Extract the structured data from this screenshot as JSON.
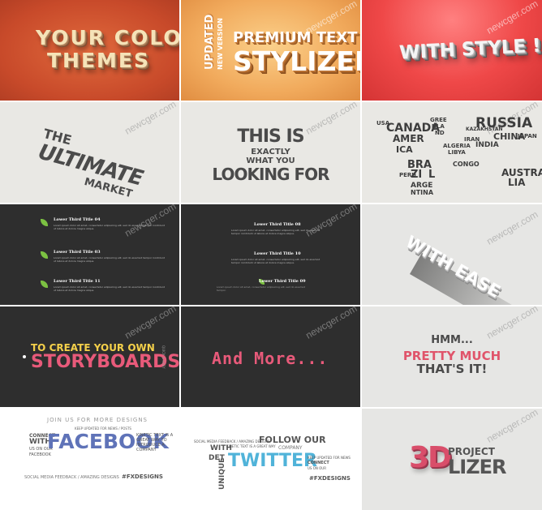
{
  "watermark": "newcger.com",
  "tiles": {
    "t1": {
      "line1": "YOUR COLOR",
      "line2": "THEMES"
    },
    "t2": {
      "side1": "UPDATED",
      "side2": "NEW VERSION",
      "line1": "PREMIUM TEXT",
      "line2": "STYLIZER"
    },
    "t3": {
      "text": "WITH STYLE !"
    },
    "t4": {
      "line1": "THE",
      "line2": "ULTIMATE",
      "line3": "MARKET"
    },
    "t5": {
      "line1": "THIS IS",
      "line2": "EXACTLY",
      "line3": "WHAT YOU",
      "line4": "LOOKING FOR"
    },
    "t6": {
      "words": [
        "USA",
        "CANADA",
        "AMER",
        "ICA",
        "GREE",
        "NLA",
        "ND",
        "RUSSIA",
        "CHINA",
        "INDIA",
        "BRA",
        "ZI",
        "L",
        "PERU",
        "ARGE",
        "NTINA",
        "AUSTRA",
        "LIA",
        "ALGERIA",
        "LIBYA",
        "CONGO",
        "KAZAKHSTAN",
        "JAPAN",
        "IRAN"
      ]
    },
    "t7": {
      "items": [
        {
          "title": "Lower Third Title 04",
          "body": "Lorem ipsum dolor sit amet, consectetur adipisicing elit, sed do eiusmod tempor incididunt ut labore et dolore magna aliqua."
        },
        {
          "title": "Lower Third Title 03",
          "body": "Lorem ipsum dolor sit amet, consectetur adipisicing elit, sed do eiusmod tempor incididunt ut labore et dolore magna aliqua."
        },
        {
          "title": "Lower Third Title 11",
          "body": "Lorem ipsum dolor sit amet, consectetur adipisicing elit, sed do eiusmod tempor incididunt ut labore et dolore magna aliqua."
        }
      ]
    },
    "t8": {
      "items": [
        {
          "title": "Lower Third Title 08",
          "body": "Lorem ipsum dolor sit amet, consectetur adipisicing elit, sed do eiusmod tempor incididunt ut labore et dolore magna aliqua."
        },
        {
          "title": "Lower Third Title 10",
          "body": "Lorem ipsum dolor sit amet, consectetur adipisicing elit, sed do eiusmod tempor incididunt ut labore et dolore magna aliqua."
        },
        {
          "title": "Lower Third Title 09",
          "body": "Lorem ipsum dolor sit amet, consectetur adipisicing elit, sed do eiusmod tempor."
        }
      ]
    },
    "t9": {
      "text": "WITH EASE"
    },
    "t10": {
      "line1": "TO CREATE YOUR OWN",
      "line2": "STORYBOARDS",
      "side": "QUICK & EASY"
    },
    "t11": {
      "text": "And More..."
    },
    "t12": {
      "line1": "HMM...",
      "line2": "PRETTY MUCH",
      "line3": "THAT'S IT!"
    },
    "t13": {
      "top": "JOIN US FOR MORE DESIGNS",
      "keep": "KEEP UPDATED FOR NEWS / POSTS",
      "big": "FACEBOOK",
      "connect": "CONNECT",
      "with": "WITH",
      "us": "US ON OUR",
      "fb": "FACEBOOK",
      "kinetic": "KINETIC TEXT IS A GREAT WAY TO INTRODUCE A COMPANY",
      "social": "SOCIAL MEDIA FEEDBACK / AMAZING DESIGNS",
      "tag": "#FXDESIGNS"
    },
    "t14": {
      "social": "SOCIAL MEDIA FEEDBACK / AMAZING DESIGNS",
      "with": "WITH",
      "det": "DET",
      "unique": "UNIQUE",
      "kinetic": "KINETIC TEXT IS A GREAT WAY",
      "follow": "FOLLOW OUR",
      "company": "COMPANY",
      "big": "TWITTER",
      "keep": "KEEP UPDATED FOR NEWS",
      "connect": "CONNECT",
      "us": "US ON OUR",
      "tag": "#FXDESIGNS"
    },
    "t15": {
      "big": "3D",
      "line1": "PROJECT",
      "line2": "LIZER"
    }
  }
}
